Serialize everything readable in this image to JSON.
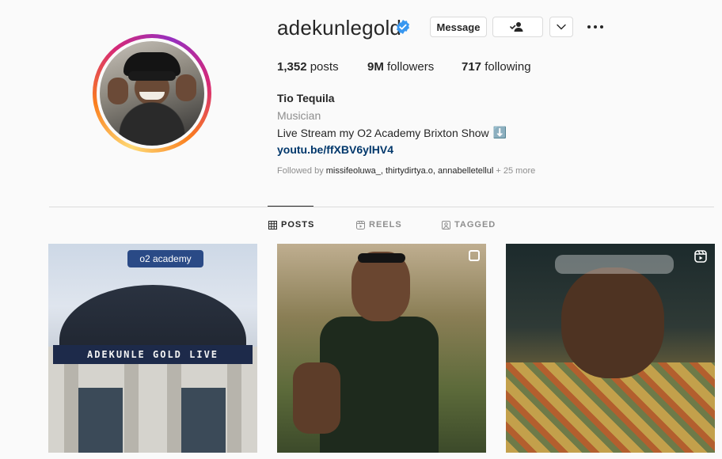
{
  "profile": {
    "username": "adekunlegold",
    "verified": true,
    "accent": "#3897f0"
  },
  "actions": {
    "message_label": "Message",
    "follow_icon": "person-check-icon",
    "suggest_icon": "chevron-down-icon",
    "more_icon": "more-horizontal-icon"
  },
  "stats": {
    "posts_count": "1,352",
    "posts_label": "posts",
    "followers_count": "9M",
    "followers_label": "followers",
    "following_count": "717",
    "following_label": "following"
  },
  "bio": {
    "name": "Tio Tequila",
    "category": "Musician",
    "text": "Live Stream my O2 Academy Brixton Show",
    "text_emoji": "⬇️",
    "link": "youtu.be/ffXBV6ylHV4",
    "followed_by_prefix": "Followed by",
    "followed_by_names": "missifeoluwa_, thirtydirtya.o, annabelletellul",
    "followed_by_more": "+ 25 more",
    "link_color": "#00376b"
  },
  "tabs": [
    {
      "label": "POSTS",
      "icon": "grid-icon",
      "active": true
    },
    {
      "label": "REELS",
      "icon": "reels-icon",
      "active": false
    },
    {
      "label": "TAGGED",
      "icon": "tagged-icon",
      "active": false
    }
  ],
  "posts": [
    {
      "sign_text": "o2 academy",
      "band_text": "ADEKUNLE GOLD LIVE",
      "badge": null
    },
    {
      "badge": "multi-image-icon"
    },
    {
      "badge": "reel-icon"
    }
  ]
}
